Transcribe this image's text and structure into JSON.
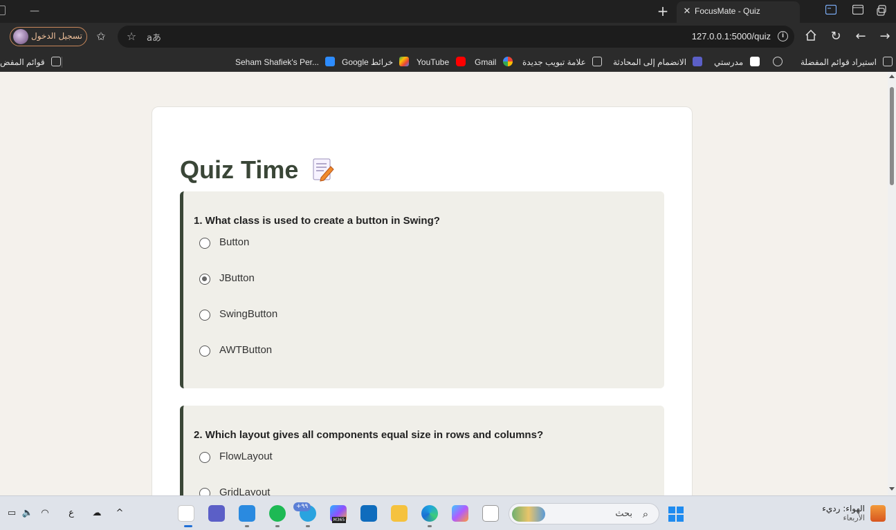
{
  "window": {
    "tab_title": "FocusMate - Quiz",
    "new_tab_icon": "plus-icon",
    "close_icon": "close-icon"
  },
  "toolbar": {
    "signin_label": "تسجيل الدخول",
    "url": "127.0.0.1:5000/quiz",
    "reader_label": "aあ"
  },
  "bookmarks": [
    {
      "label": "استيراد قوائم المفضلة",
      "icon": "import-icon"
    },
    {
      "label": "",
      "icon": "globe-icon"
    },
    {
      "label": "مدرستي",
      "icon": "madrasati-icon"
    },
    {
      "label": "الانضمام إلى المحادثة",
      "icon": "teams-icon"
    },
    {
      "label": "علامة تبويب جديدة",
      "icon": "new-tab-icon"
    },
    {
      "label": "Gmail",
      "icon": "google-icon"
    },
    {
      "label": "YouTube",
      "icon": "youtube-icon"
    },
    {
      "label": "Google خرائط",
      "icon": "maps-icon"
    },
    {
      "label": "Seham Shafiek's Per...",
      "icon": "zoom-icon"
    },
    {
      "label": "قوائم المفض",
      "icon": "folder-icon"
    }
  ],
  "page": {
    "title": "Quiz Time",
    "title_emoji": "memo-icon",
    "questions": [
      {
        "text": "1. What class is used to create a button in Swing?",
        "options": [
          "Button",
          "JButton",
          "SwingButton",
          "AWTButton"
        ],
        "selected": 1
      },
      {
        "text": "2. Which layout gives all components equal size in rows and columns?",
        "options": [
          "FlowLayout",
          "GridLayout"
        ],
        "selected": -1
      }
    ]
  },
  "taskbar": {
    "search_placeholder": "بحث",
    "weather_line1": "الهواء: رديء",
    "weather_line2": "الأربعاء",
    "language": "ع",
    "telegram_badge": "+٩٩",
    "m365_label": "M365"
  },
  "colors": {
    "page_bg": "#f4f1ec",
    "accent": "#3a4637",
    "question_bg": "#f0efe9",
    "chrome_dark": "#202020"
  }
}
